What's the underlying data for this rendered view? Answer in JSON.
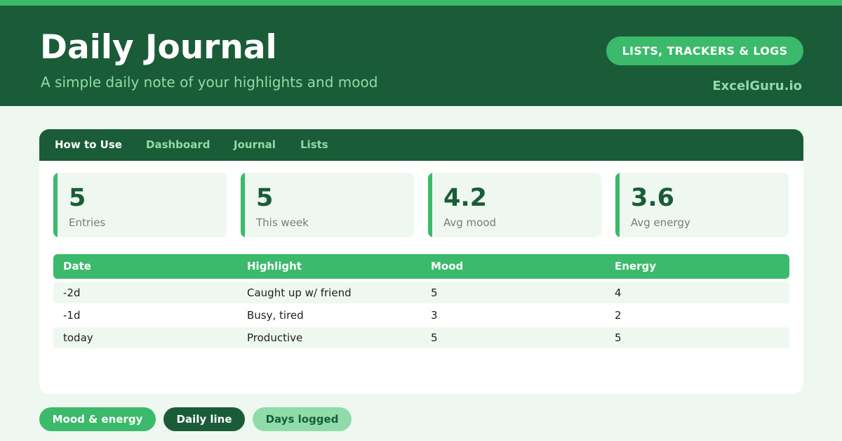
{
  "header": {
    "title": "Daily Journal",
    "subtitle": "A simple daily note of your highlights and mood",
    "badge": "LISTS, TRACKERS & LOGS",
    "brand": "ExcelGuru.io"
  },
  "tabs": [
    {
      "label": "How to Use",
      "active": true
    },
    {
      "label": "Dashboard",
      "active": false
    },
    {
      "label": "Journal",
      "active": false
    },
    {
      "label": "Lists",
      "active": false
    }
  ],
  "stats": [
    {
      "value": "5",
      "label": "Entries"
    },
    {
      "value": "5",
      "label": "This week"
    },
    {
      "value": "4.2",
      "label": "Avg mood"
    },
    {
      "value": "3.6",
      "label": "Avg energy"
    }
  ],
  "table": {
    "columns": [
      "Date",
      "Highlight",
      "Mood",
      "Energy"
    ],
    "rows": [
      [
        "-2d",
        "Caught up w/ friend",
        "5",
        "4"
      ],
      [
        "-1d",
        "Busy, tired",
        "3",
        "2"
      ],
      [
        "today",
        "Productive",
        "5",
        "5"
      ]
    ]
  },
  "pills": [
    {
      "label": "Mood & energy"
    },
    {
      "label": "Daily line"
    },
    {
      "label": "Days logged"
    }
  ],
  "colors": {
    "dark_green": "#1a5c37",
    "accent_green": "#3aba6a",
    "light_green": "#8fdcaa",
    "background": "#eef8f0"
  }
}
